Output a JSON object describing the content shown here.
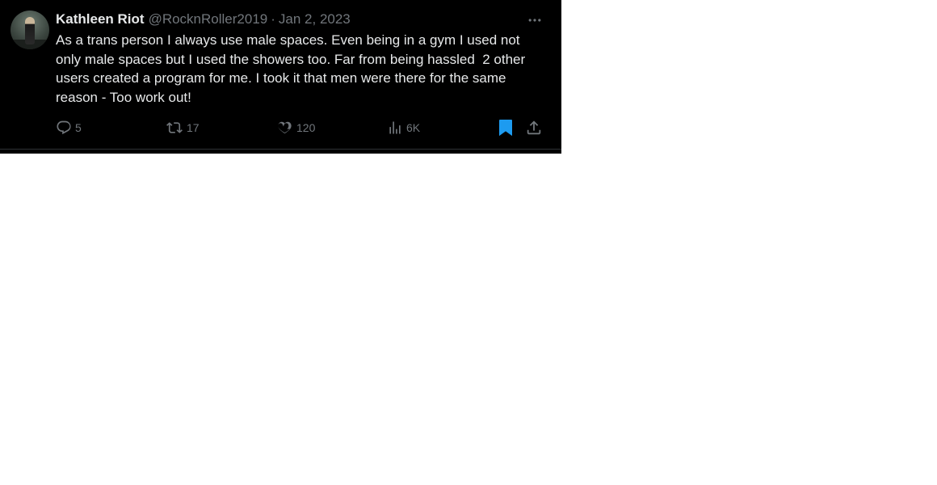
{
  "tweet": {
    "display_name": "Kathleen Riot",
    "handle": "@RocknRoller2019",
    "separator": "·",
    "date": "Jan 2, 2023",
    "text": "As a trans person I always use male spaces. Even being in a gym I used not only male spaces but I used the showers too. Far from being hassled  2 other users created a program for me. I took it that men were there for the same reason - Too work out!",
    "more_icon": "more-horizontal-icon",
    "avatar": "profile-photo"
  },
  "actions": {
    "reply": {
      "icon": "reply-icon",
      "count": "5"
    },
    "retweet": {
      "icon": "retweet-icon",
      "count": "17"
    },
    "like": {
      "icon": "heart-icon",
      "count": "120"
    },
    "views": {
      "icon": "analytics-icon",
      "count": "6K"
    },
    "bookmark": {
      "icon": "bookmark-icon",
      "active": true
    },
    "share": {
      "icon": "share-icon"
    }
  },
  "colors": {
    "background": "#000000",
    "text_primary": "#e7e9ea",
    "text_secondary": "#71767b",
    "bookmark_active": "#1d9bf0",
    "page_background": "#ffffff"
  }
}
